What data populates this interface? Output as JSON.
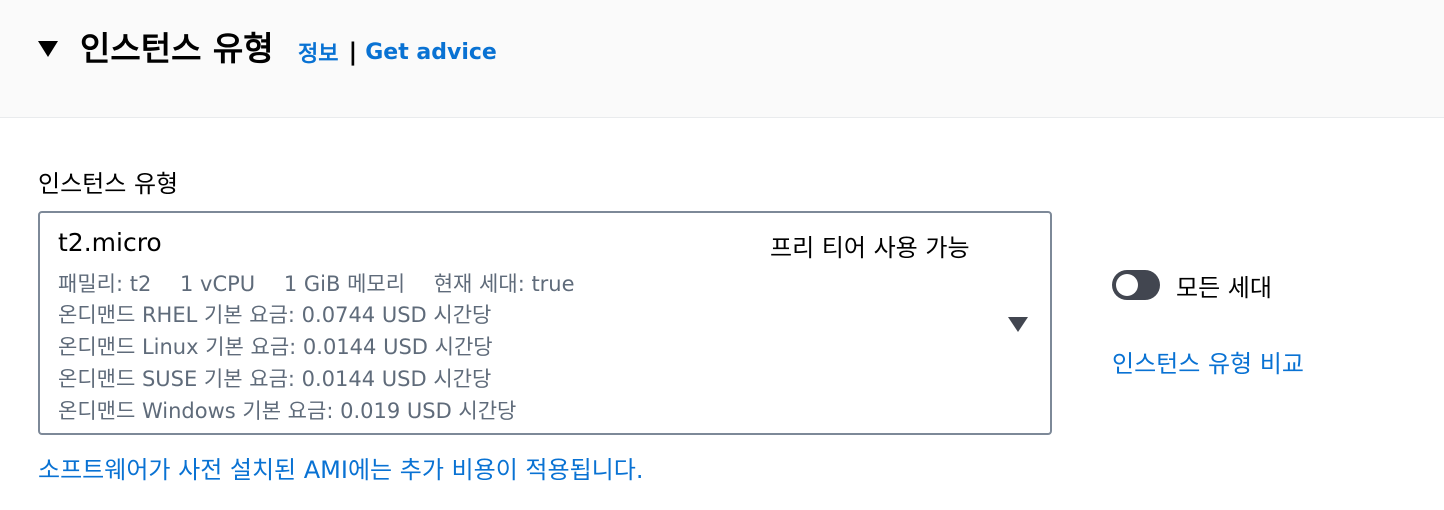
{
  "header": {
    "title": "인스턴스 유형",
    "info_link": "정보",
    "separator": "|",
    "advice_link": "Get advice"
  },
  "field": {
    "label": "인스턴스 유형"
  },
  "selected": {
    "name": "t2.micro",
    "badge": "프리 티어 사용 가능",
    "family": "패밀리: t2",
    "vcpu": "1 vCPU",
    "memory": "1 GiB 메모리",
    "generation": "현재 세대: true",
    "prices": [
      "온디맨드 RHEL 기본 요금: 0.0744 USD 시간당",
      "온디맨드 Linux 기본 요금: 0.0144 USD 시간당",
      "온디맨드 SUSE 기본 요금: 0.0144 USD 시간당",
      "온디맨드 Windows 기본 요금: 0.019 USD 시간당"
    ]
  },
  "toggle": {
    "label": "모든 세대",
    "checked": false
  },
  "compare_link": "인스턴스 유형 비교",
  "ami_note": "소프트웨어가 사전 설치된 AMI에는 추가 비용이 적용됩니다.",
  "colors": {
    "link": "#0972d3",
    "toggle_off": "#424650",
    "header_bg": "#fafafa"
  }
}
